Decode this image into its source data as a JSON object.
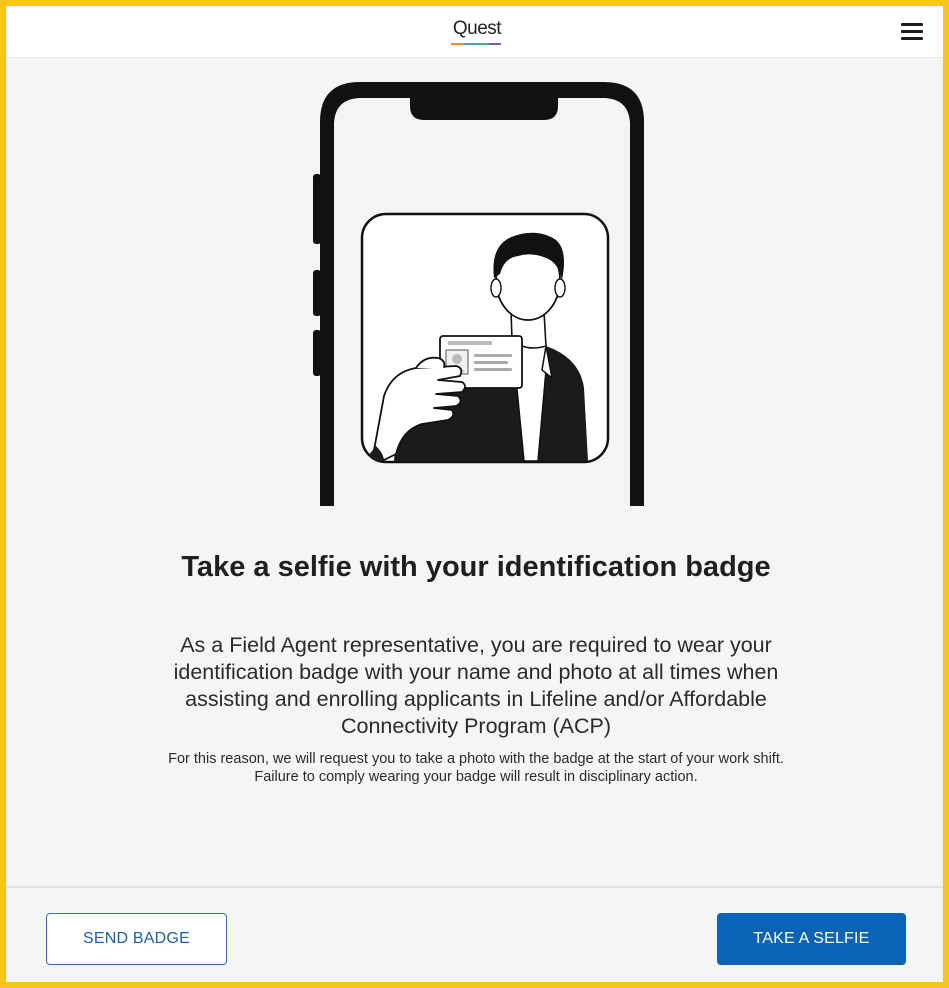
{
  "header": {
    "logo_text": "Quest",
    "logo_icon": "quest-logo",
    "logo_colors": [
      "#e88b2e",
      "#4a9ad4",
      "#3bb08f",
      "#7b5ea7"
    ],
    "menu_icon": "hamburger-menu-icon"
  },
  "illustration": {
    "icon": "phone-selfie-with-badge-illustration"
  },
  "content": {
    "title": "Take a selfie with your identification badge",
    "body": "As a Field Agent representative, you are required to wear your identification badge with your name and photo at all times when assisting and enrolling applicants in Lifeline and/or Affordable Connectivity Program (ACP)",
    "note": "For this reason, we will request you to take a photo with the badge at the start of your work shift. Failure to comply wearing your badge will result in disciplinary action."
  },
  "footer": {
    "send_badge_label": "SEND BADGE",
    "take_selfie_label": "TAKE A SELFIE"
  },
  "colors": {
    "frame_border": "#f7c41c",
    "primary": "#0a63b4",
    "background": "#f5f5f5"
  }
}
